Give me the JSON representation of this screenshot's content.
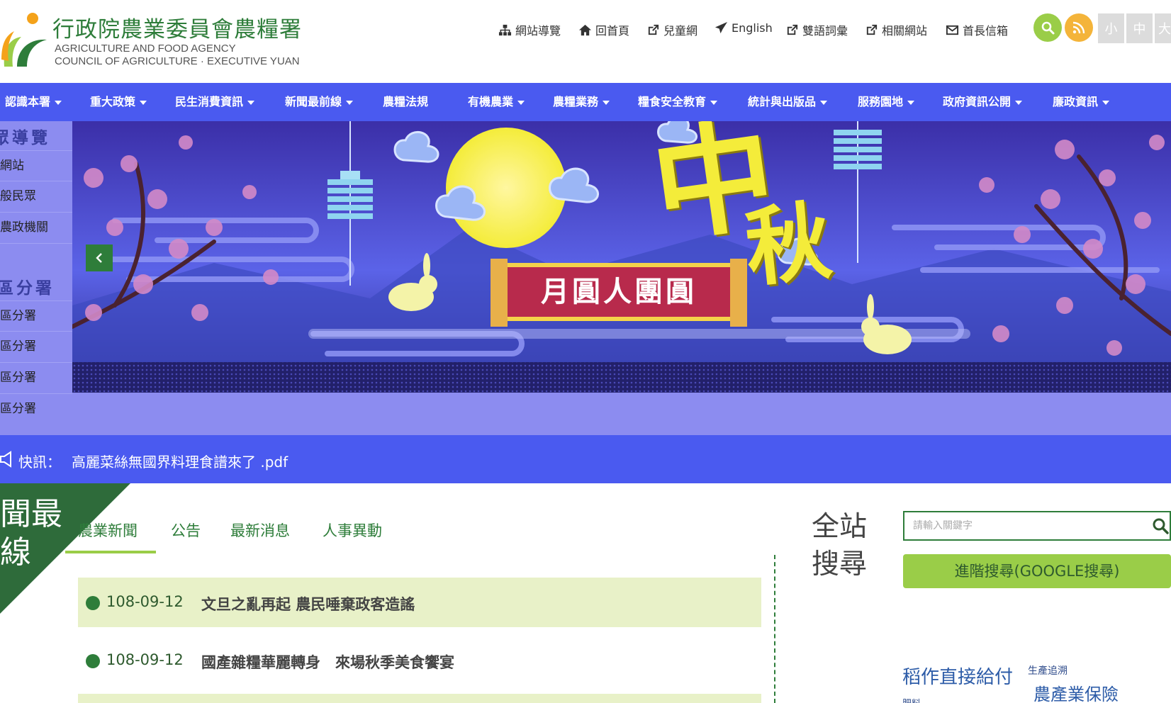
{
  "header": {
    "logo_title": "行政院農業委員會農糧署",
    "logo_en_line1": "AGRICULTURE AND FOOD AGENCY",
    "logo_en_line2": "COUNCIL OF AGRICULTURE · EXECUTIVE YUAN",
    "utility_links": [
      {
        "label": "網站導覽",
        "icon": "sitemap-icon"
      },
      {
        "label": "回首頁",
        "icon": "home-icon"
      },
      {
        "label": "兒童網",
        "icon": "external-link-icon"
      },
      {
        "label": "English",
        "icon": "paper-plane-icon"
      },
      {
        "label": "雙語詞彙",
        "icon": "external-link-icon"
      },
      {
        "label": "相關網站",
        "icon": "external-link-icon"
      },
      {
        "label": "首長信箱",
        "icon": "envelope-icon"
      }
    ],
    "search_icon": "search-icon",
    "rss_icon": "rss-icon",
    "font_sizes": [
      "小",
      "中",
      "大"
    ],
    "colors": {
      "brand_green": "#2e7d3a",
      "search_btn": "#9acd48",
      "rss_btn": "#f4b43a"
    }
  },
  "nav": {
    "color": "#4a5af0",
    "items": [
      {
        "label": "認識本署",
        "has_dropdown": true
      },
      {
        "label": "重大政策",
        "has_dropdown": true
      },
      {
        "label": "民生消費資訊",
        "has_dropdown": true
      },
      {
        "label": "新聞最前線",
        "has_dropdown": true
      },
      {
        "label": "農糧法規",
        "has_dropdown": false
      },
      {
        "label": "有機農業",
        "has_dropdown": true
      },
      {
        "label": "農糧業務",
        "has_dropdown": true
      },
      {
        "label": "糧食安全教育",
        "has_dropdown": true
      },
      {
        "label": "統計與出版品",
        "has_dropdown": true
      },
      {
        "label": "服務園地",
        "has_dropdown": true
      },
      {
        "label": "政府資訊公開",
        "has_dropdown": true
      },
      {
        "label": "廉政資訊",
        "has_dropdown": true
      }
    ]
  },
  "sidebar": {
    "heading1": "眾導覽",
    "group1": [
      "網站",
      "般民眾",
      "農政機關"
    ],
    "heading2": "區分署",
    "group2": [
      "區分署",
      "區分署",
      "區分署",
      "區分署"
    ]
  },
  "banner": {
    "calligraphy_1": "中",
    "calligraphy_2": "秋",
    "scroll_text": "月圓人團圓",
    "prev_icon": "chevron-left-icon"
  },
  "flash": {
    "icon": "megaphone-icon",
    "label": "快訊：",
    "text": "高麗菜絲無國界料理食譜來了 .pdf"
  },
  "news": {
    "corner_line1": "聞最",
    "corner_line2": "線",
    "tabs": [
      "農業新聞",
      "公告",
      "最新消息",
      "人事異動"
    ],
    "active_tab": 0,
    "items": [
      {
        "date": "108-09-12",
        "title": "文旦之亂再起 農民唾棄政客造謠"
      },
      {
        "date": "108-09-12",
        "title": "國產雜糧華麗轉身　來場秋季美食饗宴"
      }
    ]
  },
  "search": {
    "title_line1": "全站",
    "title_line2": "搜尋",
    "placeholder": "請輸入關鍵字",
    "advanced_label": "進階搜尋(GOOGLE搜尋)"
  },
  "tags": {
    "items": [
      "稻作直接給付",
      "生產追溯",
      "農產業保險",
      "肥料"
    ]
  }
}
